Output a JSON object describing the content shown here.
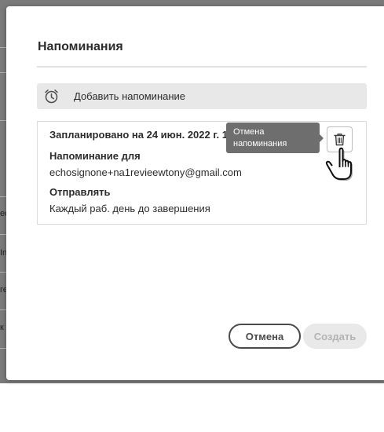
{
  "dialog": {
    "title": "Напоминания",
    "add_reminder_label": "Добавить напоминание",
    "reminder": {
      "scheduled_text": "Запланировано на 24 июн. 2022 г. 17:",
      "recipient_heading": "Напоминание для",
      "recipient_value": "echosignone+na1revieewtony@gmail.com",
      "send_heading": "Отправлять",
      "send_value": "Каждый раб. день до завершения"
    },
    "tooltip_text": "Отмена напоминания",
    "cancel_label": "Отмена",
    "create_label": "Создать"
  },
  "background": {
    "row_fragments": [
      "ес",
      "In",
      "ге",
      "к"
    ]
  },
  "icons": {
    "add_reminder": "alarm-clock-icon",
    "delete": "trash-icon",
    "cursor": "hand-pointer-icon"
  },
  "colors": {
    "overlay": "#7a7a7a",
    "tooltip": "#6e6e6e",
    "add_bar": "#e8e8e8",
    "create_disabled": "#e9e9e9"
  }
}
